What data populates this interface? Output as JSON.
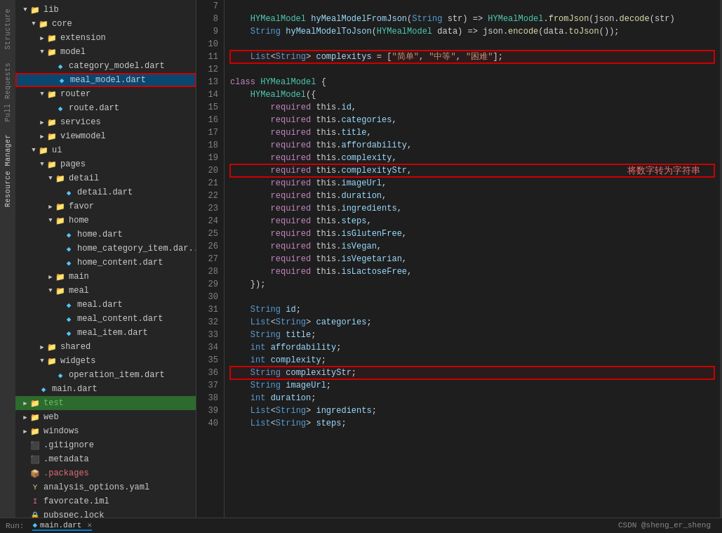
{
  "sidebar": {
    "tabs": [
      {
        "label": "Structure",
        "active": false
      },
      {
        "label": "Pull Requests",
        "active": false
      },
      {
        "label": "Resource Manager",
        "active": true
      }
    ],
    "tree": [
      {
        "id": "lib",
        "label": "lib",
        "indent": 1,
        "type": "folder-open",
        "expanded": true,
        "arrow": "▼"
      },
      {
        "id": "core",
        "label": "core",
        "indent": 2,
        "type": "folder-open",
        "expanded": true,
        "arrow": "▼"
      },
      {
        "id": "extension",
        "label": "extension",
        "indent": 3,
        "type": "folder",
        "expanded": false,
        "arrow": "▶"
      },
      {
        "id": "model",
        "label": "model",
        "indent": 3,
        "type": "folder-open",
        "expanded": true,
        "arrow": "▼"
      },
      {
        "id": "category_model.dart",
        "label": "category_model.dart",
        "indent": 4,
        "type": "dart"
      },
      {
        "id": "meal_model.dart",
        "label": "meal_model.dart",
        "indent": 4,
        "type": "dart",
        "selected": true
      },
      {
        "id": "router",
        "label": "router",
        "indent": 3,
        "type": "folder-open",
        "expanded": true,
        "arrow": "▼"
      },
      {
        "id": "route.dart",
        "label": "route.dart",
        "indent": 4,
        "type": "dart"
      },
      {
        "id": "services",
        "label": "services",
        "indent": 3,
        "type": "folder",
        "expanded": false,
        "arrow": "▶"
      },
      {
        "id": "viewmodel",
        "label": "viewmodel",
        "indent": 3,
        "type": "folder",
        "expanded": false,
        "arrow": "▶"
      },
      {
        "id": "ui",
        "label": "ui",
        "indent": 2,
        "type": "folder-open",
        "expanded": true,
        "arrow": "▼"
      },
      {
        "id": "pages",
        "label": "pages",
        "indent": 3,
        "type": "folder-open",
        "expanded": true,
        "arrow": "▼"
      },
      {
        "id": "detail",
        "label": "detail",
        "indent": 4,
        "type": "folder-open",
        "expanded": true,
        "arrow": "▼"
      },
      {
        "id": "detail.dart",
        "label": "detail.dart",
        "indent": 5,
        "type": "dart"
      },
      {
        "id": "favor",
        "label": "favor",
        "indent": 4,
        "type": "folder",
        "expanded": false,
        "arrow": "▶"
      },
      {
        "id": "home",
        "label": "home",
        "indent": 4,
        "type": "folder-open",
        "expanded": true,
        "arrow": "▼"
      },
      {
        "id": "home.dart",
        "label": "home.dart",
        "indent": 5,
        "type": "dart"
      },
      {
        "id": "home_category_item.dart",
        "label": "home_category_item.dar...",
        "indent": 5,
        "type": "dart"
      },
      {
        "id": "home_content.dart",
        "label": "home_content.dart",
        "indent": 5,
        "type": "dart"
      },
      {
        "id": "main",
        "label": "main",
        "indent": 4,
        "type": "folder",
        "expanded": false,
        "arrow": "▶"
      },
      {
        "id": "meal",
        "label": "meal",
        "indent": 4,
        "type": "folder-open",
        "expanded": true,
        "arrow": "▼"
      },
      {
        "id": "meal.dart",
        "label": "meal.dart",
        "indent": 5,
        "type": "dart"
      },
      {
        "id": "meal_content.dart",
        "label": "meal_content.dart",
        "indent": 5,
        "type": "dart"
      },
      {
        "id": "meal_item.dart",
        "label": "meal_item.dart",
        "indent": 5,
        "type": "dart"
      },
      {
        "id": "shared",
        "label": "shared",
        "indent": 3,
        "type": "folder",
        "expanded": false,
        "arrow": "▶"
      },
      {
        "id": "widgets",
        "label": "widgets",
        "indent": 3,
        "type": "folder-open",
        "expanded": true,
        "arrow": "▼"
      },
      {
        "id": "operation_item.dart",
        "label": "operation_item.dart",
        "indent": 4,
        "type": "dart"
      },
      {
        "id": "main.dart",
        "label": "main.dart",
        "indent": 2,
        "type": "dart"
      },
      {
        "id": "test",
        "label": "test",
        "indent": 1,
        "type": "folder",
        "expanded": false,
        "arrow": "▶",
        "color": "green"
      },
      {
        "id": "web",
        "label": "web",
        "indent": 1,
        "type": "folder",
        "expanded": false,
        "arrow": "▶"
      },
      {
        "id": "windows",
        "label": "windows",
        "indent": 1,
        "type": "folder",
        "expanded": false,
        "arrow": "▶"
      },
      {
        "id": ".gitignore",
        "label": ".gitignore",
        "indent": 1,
        "type": "gitignore"
      },
      {
        "id": ".metadata",
        "label": ".metadata",
        "indent": 1,
        "type": "metadata"
      },
      {
        "id": ".packages",
        "label": ".packages",
        "indent": 1,
        "type": "packages"
      },
      {
        "id": "analysis_options.yaml",
        "label": "analysis_options.yaml",
        "indent": 1,
        "type": "yaml"
      },
      {
        "id": "favorcate.iml",
        "label": "favorcate.iml",
        "indent": 1,
        "type": "iml"
      },
      {
        "id": "pubspec.lock",
        "label": "pubspec.lock",
        "indent": 1,
        "type": "lock"
      }
    ]
  },
  "code": {
    "filename": "meal_model.dart",
    "lines": [
      {
        "num": 7,
        "content": "",
        "highlight": false
      },
      {
        "num": 8,
        "content": "    HYMealModel hyMealModelFromJson(String str) => HYMealModel.fromJson(json.decode(str)",
        "highlight": false
      },
      {
        "num": 9,
        "content": "    String hyMealModelToJson(HYMealModel data) => json.encode(data.toJson());",
        "highlight": false
      },
      {
        "num": 10,
        "content": "",
        "highlight": false
      },
      {
        "num": 11,
        "content": "    List<String> complexitys = [\"简单\", \"中等\", \"困难\"];",
        "highlight": true,
        "box": true
      },
      {
        "num": 12,
        "content": "",
        "highlight": false
      },
      {
        "num": 13,
        "content": "class HYMealModel {",
        "highlight": false
      },
      {
        "num": 14,
        "content": "    HYMealModel({",
        "highlight": false
      },
      {
        "num": 15,
        "content": "        required this.id,",
        "highlight": false
      },
      {
        "num": 16,
        "content": "        required this.categories,",
        "highlight": false
      },
      {
        "num": 17,
        "content": "        required this.title,",
        "highlight": false
      },
      {
        "num": 18,
        "content": "        required this.affordability,",
        "highlight": false
      },
      {
        "num": 19,
        "content": "        required this.complexity,",
        "highlight": false
      },
      {
        "num": 20,
        "content": "        required this.complexityStr,",
        "highlight": false,
        "box": true,
        "annotation": "将数字转为字符串"
      },
      {
        "num": 21,
        "content": "        required this.imageUrl,",
        "highlight": false
      },
      {
        "num": 22,
        "content": "        required this.duration,",
        "highlight": false
      },
      {
        "num": 23,
        "content": "        required this.ingredients,",
        "highlight": false
      },
      {
        "num": 24,
        "content": "        required this.steps,",
        "highlight": false
      },
      {
        "num": 25,
        "content": "        required this.isGlutenFree,",
        "highlight": false
      },
      {
        "num": 26,
        "content": "        required this.isVegan,",
        "highlight": false
      },
      {
        "num": 27,
        "content": "        required this.isVegetarian,",
        "highlight": false
      },
      {
        "num": 28,
        "content": "        required this.isLactoseFree,",
        "highlight": false
      },
      {
        "num": 29,
        "content": "    });",
        "highlight": false
      },
      {
        "num": 30,
        "content": "",
        "highlight": false
      },
      {
        "num": 31,
        "content": "    String id;",
        "highlight": false
      },
      {
        "num": 32,
        "content": "    List<String> categories;",
        "highlight": false
      },
      {
        "num": 33,
        "content": "    String title;",
        "highlight": false
      },
      {
        "num": 34,
        "content": "    int affordability;",
        "highlight": false
      },
      {
        "num": 35,
        "content": "    int complexity;",
        "highlight": false
      },
      {
        "num": 36,
        "content": "    String complexityStr;",
        "highlight": false,
        "box": true
      },
      {
        "num": 37,
        "content": "    String imageUrl;",
        "highlight": false
      },
      {
        "num": 38,
        "content": "    int duration;",
        "highlight": false
      },
      {
        "num": 39,
        "content": "    List<String> ingredients;",
        "highlight": false
      },
      {
        "num": 40,
        "content": "    List<String> steps;",
        "highlight": false
      }
    ]
  },
  "bottom_bar": {
    "run_label": "Run:",
    "tab_label": "main.dart",
    "watermark": "CSDN @sheng_er_sheng"
  }
}
